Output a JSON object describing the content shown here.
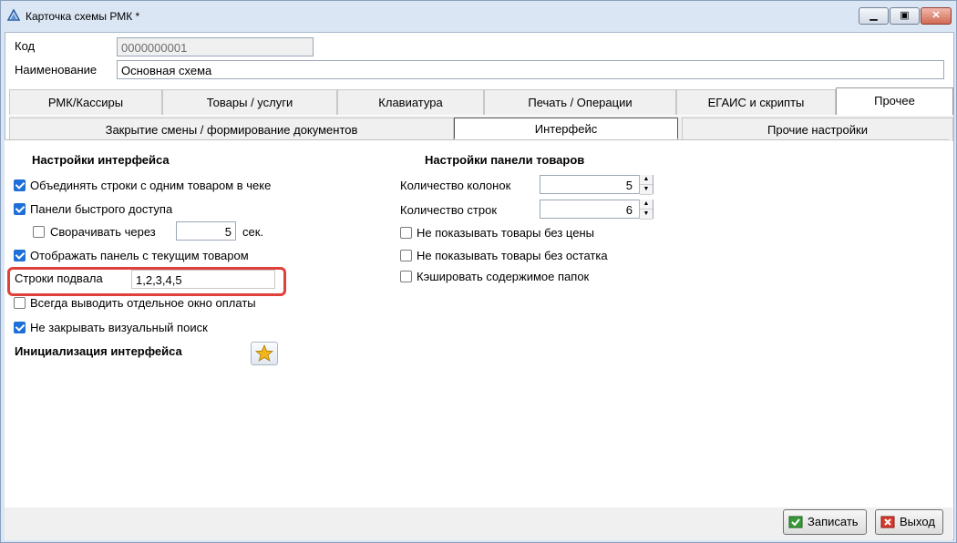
{
  "window": {
    "title": "Карточка схемы РМК *"
  },
  "header": {
    "code_label": "Код",
    "code_value": "0000000001",
    "name_label": "Наименование",
    "name_value": "Основная схема"
  },
  "tabs_top": [
    {
      "label": "РМК/Кассиры"
    },
    {
      "label": "Товары / услуги"
    },
    {
      "label": "Клавиатура"
    },
    {
      "label": "Печать / Операции"
    },
    {
      "label": "ЕГАИС и скрипты"
    },
    {
      "label": "Прочее"
    }
  ],
  "tabs_sub": [
    {
      "label": "Закрытие смены / формирование документов"
    },
    {
      "label": "Интерфейс"
    },
    {
      "label": "Прочие настройки"
    }
  ],
  "interface": {
    "heading": "Настройки интерфейса",
    "merge_rows": {
      "label": "Объединять строки с одним товаром в чеке",
      "checked": true
    },
    "quick_panels": {
      "label": "Панели быстрого доступа",
      "checked": true
    },
    "collapse_after": {
      "label": "Сворачивать через",
      "checked": false,
      "value": "5",
      "unit": "сек."
    },
    "current_item_panel": {
      "label": "Отображать панель с текущим товаром",
      "checked": true
    },
    "footer_rows": {
      "label": "Строки подвала",
      "value": "1,2,3,4,5"
    },
    "separate_payment": {
      "label": "Всегда выводить отдельное окно оплаты",
      "checked": false
    },
    "keep_visual_search": {
      "label": "Не закрывать визуальный поиск",
      "checked": true
    },
    "init_label": "Инициализация интерфейса"
  },
  "product_panel": {
    "heading": "Настройки панели товаров",
    "columns_label": "Количество колонок",
    "columns_value": "5",
    "rows_label": "Количество строк",
    "rows_value": "6",
    "hide_no_price": {
      "label": "Не показывать товары без цены",
      "checked": false
    },
    "hide_no_stock": {
      "label": "Не показывать товары без остатка",
      "checked": false
    },
    "cache_folders": {
      "label": "Кэшировать содержимое папок",
      "checked": false
    }
  },
  "footer": {
    "save_label": "Записать",
    "exit_label": "Выход"
  },
  "colors": {
    "accent": "#1e6fd9",
    "highlight": "#e0403a"
  }
}
